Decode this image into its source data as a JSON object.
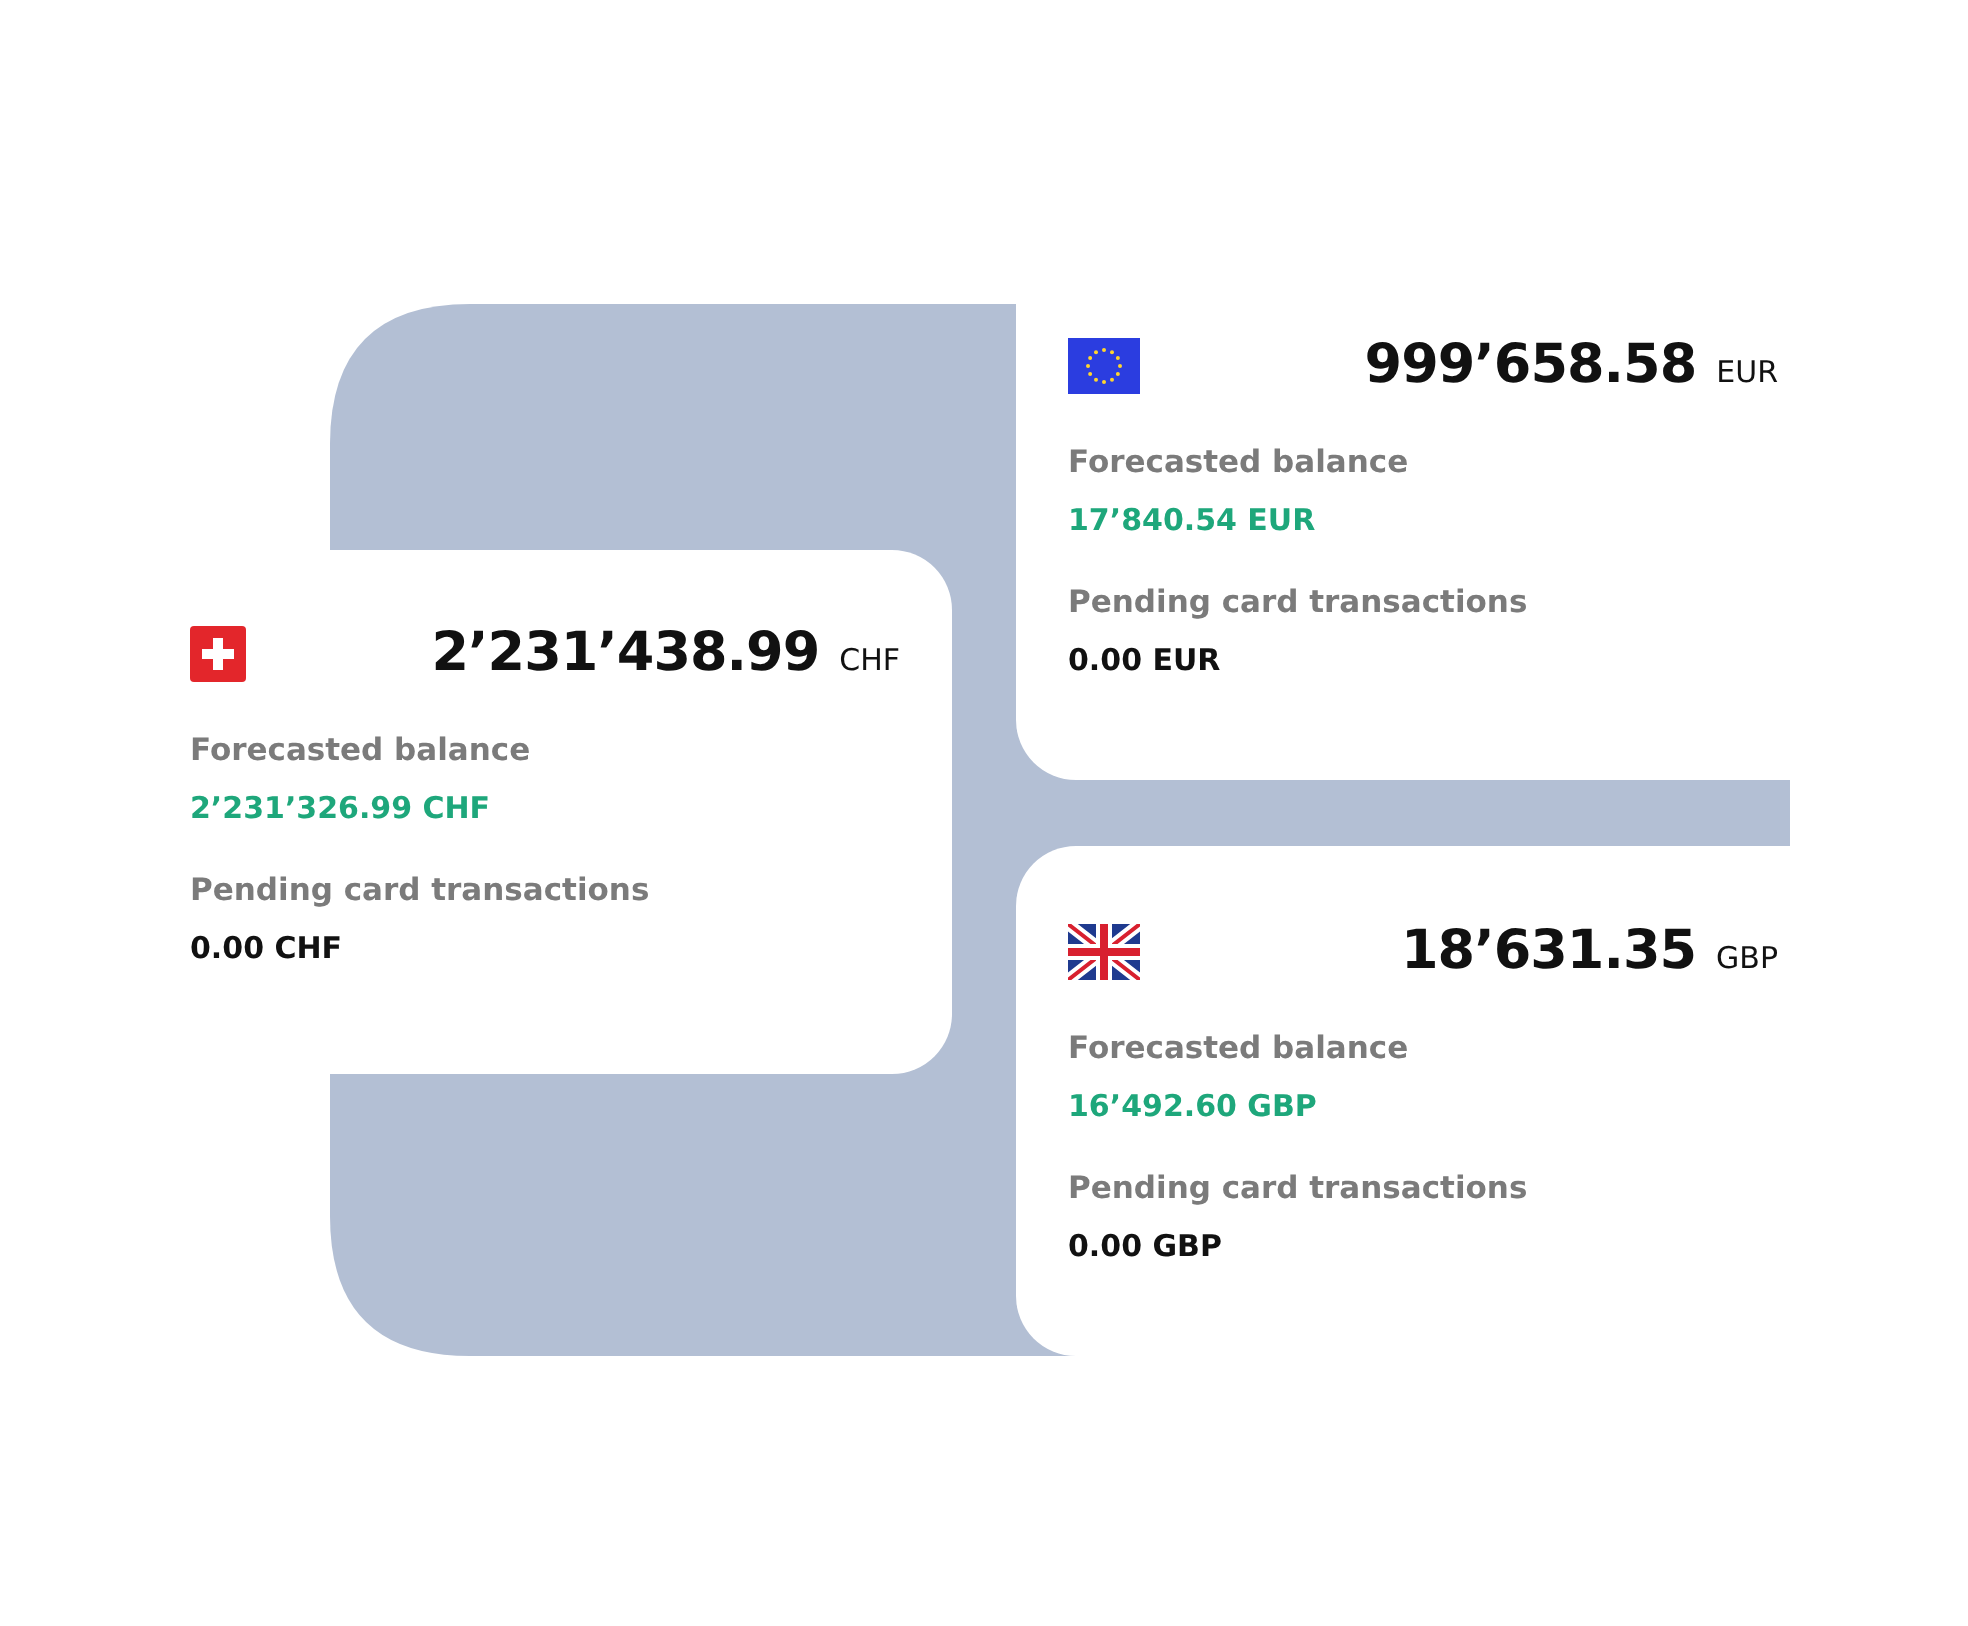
{
  "accounts": [
    {
      "kind": "ch",
      "amount": "2’231’438.99",
      "currency": "CHF",
      "forecast_label": "Forecasted balance",
      "forecast_value": "2’231’326.99 CHF",
      "pending_label": "Pending card transactions",
      "pending_value": "0.00 CHF"
    },
    {
      "kind": "eu",
      "amount": "999’658.58",
      "currency": "EUR",
      "forecast_label": "Forecasted balance",
      "forecast_value": "17’840.54 EUR",
      "pending_label": "Pending card transactions",
      "pending_value": "0.00 EUR"
    },
    {
      "kind": "gb",
      "amount": "18’631.35",
      "currency": "GBP",
      "forecast_label": "Forecasted balance",
      "forecast_value": "16’492.60 GBP",
      "pending_label": "Pending card transactions",
      "pending_value": "0.00 GBP"
    }
  ]
}
